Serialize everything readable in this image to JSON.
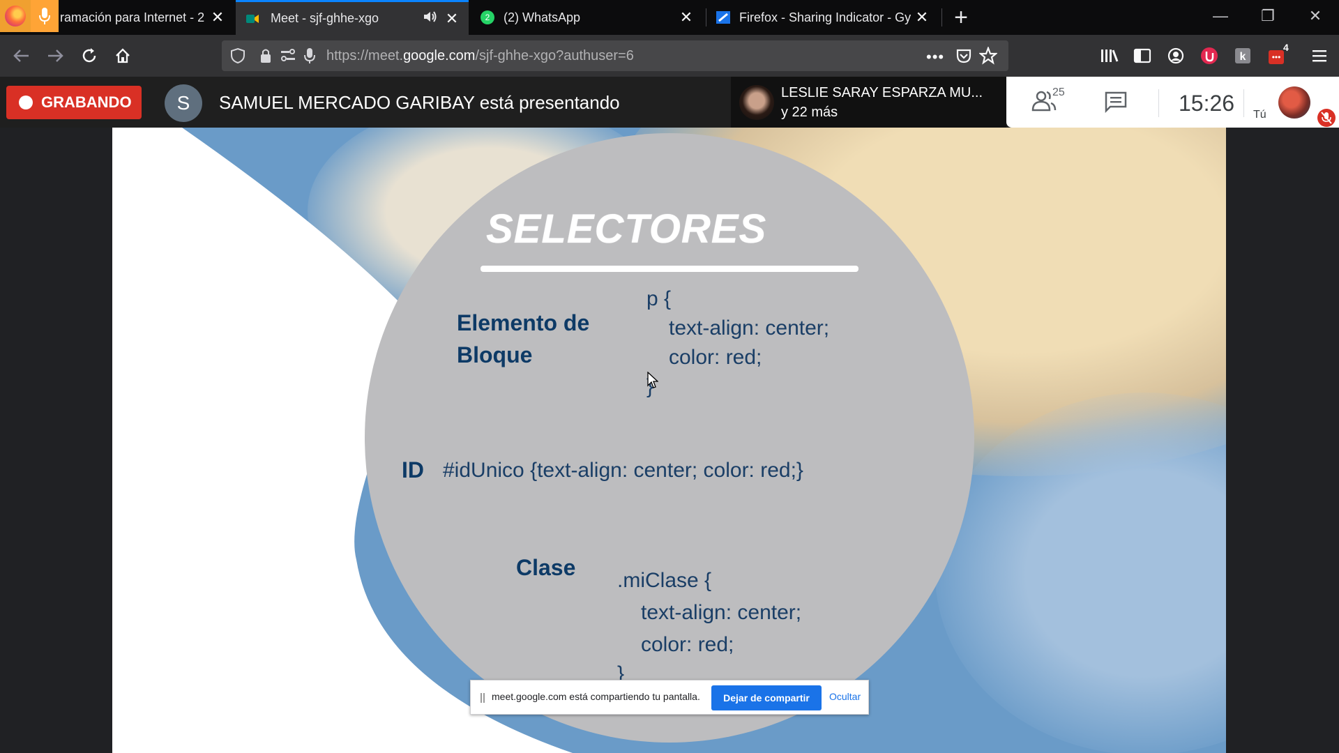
{
  "browser": {
    "tabs": [
      {
        "label": "ramación para Internet - 2",
        "active": false
      },
      {
        "label": "Meet - sjf-ghhe-xgo",
        "active": true
      },
      {
        "label": "(2) WhatsApp",
        "active": false
      },
      {
        "label": "Firefox - Sharing Indicator - Gy",
        "active": false
      }
    ],
    "new_tab_symbol": "+",
    "window_controls": {
      "minimize": "—",
      "restore": "❐",
      "close": "✕"
    },
    "url_prefix": "https://meet.",
    "url_domain": "google.com",
    "url_path": "/sjf-ghhe-xgo?authuser=6",
    "extension_badge_count": "4",
    "icons": [
      "back-icon",
      "forward-icon",
      "reload-icon",
      "home-icon",
      "shield-icon",
      "lock-icon",
      "permissions-icon",
      "microphone-icon",
      "more-icon",
      "pocket-icon",
      "star-icon",
      "library-icon",
      "sidebar-icon",
      "account-icon",
      "extension-icon",
      "menu-icon"
    ]
  },
  "meet": {
    "recording_label": "GRABANDO",
    "presenter_initial": "S",
    "presenter_text": "SAMUEL MERCADO GARIBAY está presentando",
    "participant_name": "LESLIE SARAY ESPARZA MU...",
    "participant_more": "y 22 más",
    "people_count": "25",
    "clock": "15:26",
    "self_label": "Tú",
    "accent_color": "#d93025"
  },
  "slide": {
    "title": "SELECTORES",
    "block_label_1": "Elemento de",
    "block_label_2": "Bloque",
    "block_code_1": "p {",
    "block_code_2": "text-align: center;",
    "block_code_3": "color: red;",
    "block_code_4": "}",
    "id_label": "ID",
    "id_code": "#idUnico {text-align: center; color: red;}",
    "class_label": "Clase",
    "class_code_1": ".miClase {",
    "class_code_2": "text-align: center;",
    "class_code_3": "color: red;",
    "class_code_4": "}"
  },
  "sharing_bar": {
    "message": "meet.google.com está compartiendo tu pantalla.",
    "stop_label": "Dejar de compartir",
    "hide_label": "Ocultar"
  }
}
